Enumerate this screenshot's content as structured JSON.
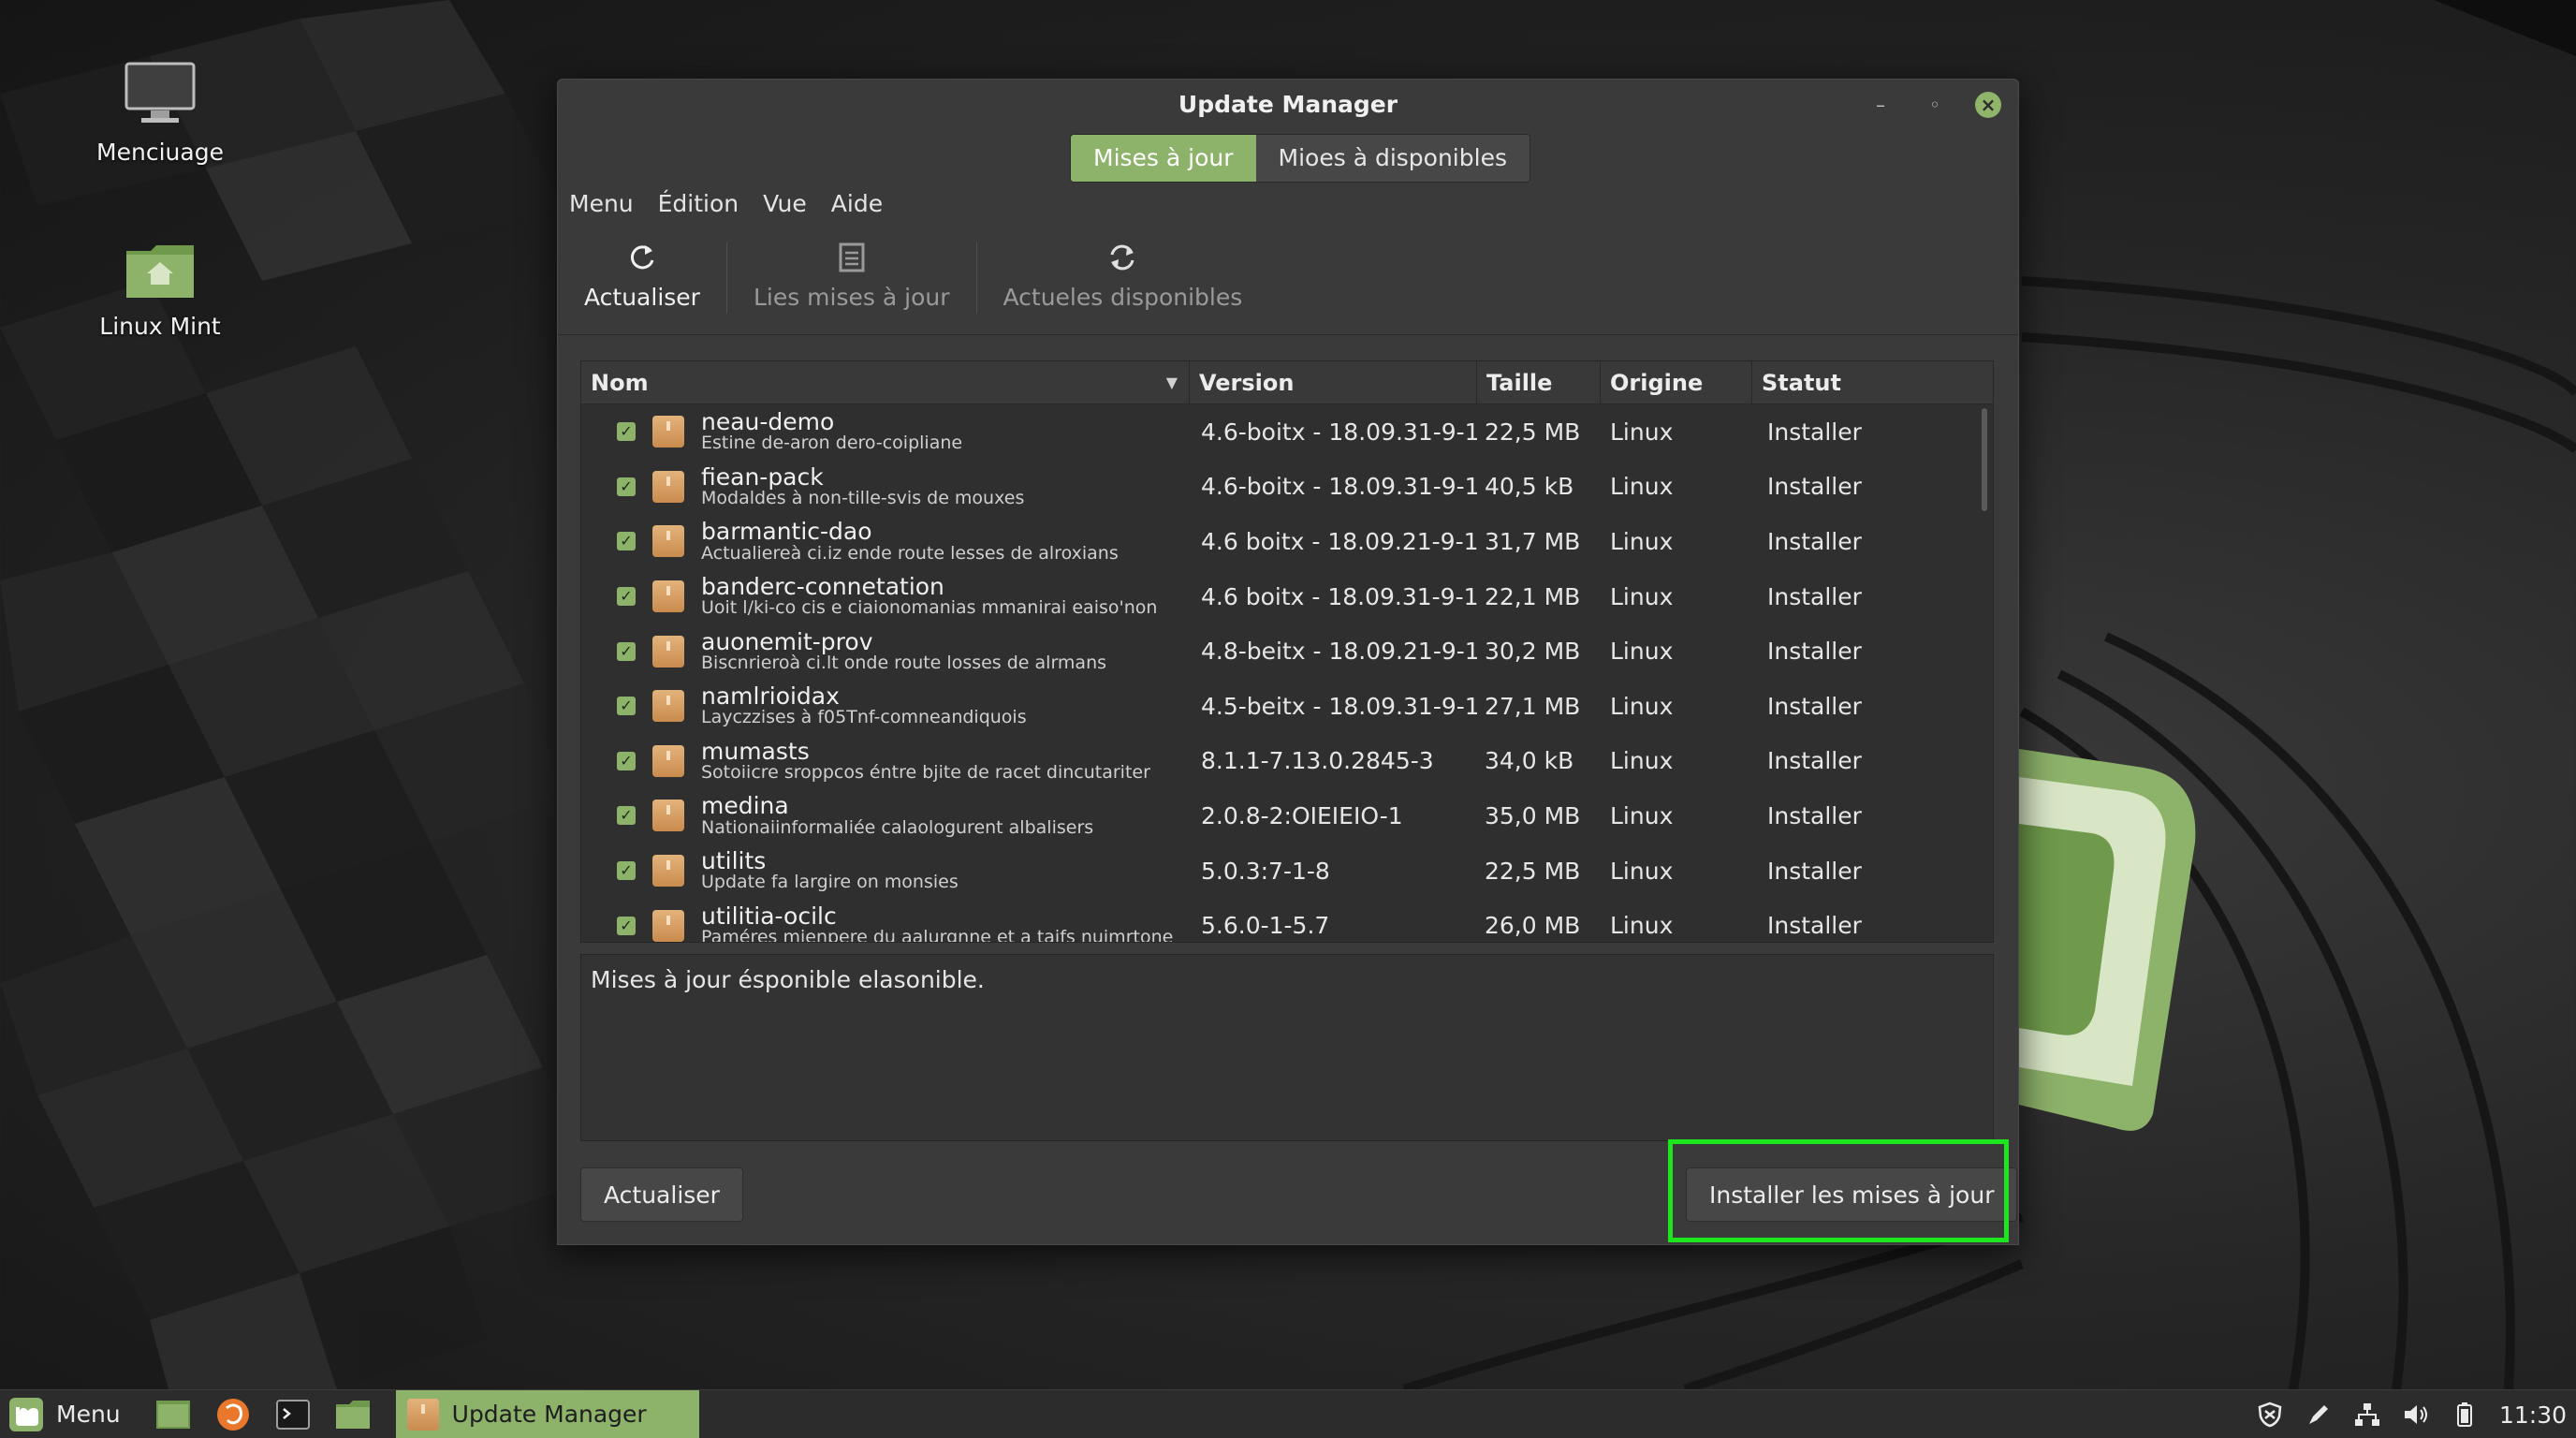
{
  "desktop": {
    "icons": [
      {
        "label": "Menciuage"
      },
      {
        "label": "Linux Mint"
      }
    ]
  },
  "window": {
    "title": "Update Manager",
    "stack_tabs": [
      "Mises à jour",
      "Mioes à disponibles"
    ],
    "menu": [
      "Menu",
      "Édition",
      "Vue",
      "Aide"
    ],
    "toolbar": [
      {
        "label": "Actualiser",
        "icon": "refresh-icon"
      },
      {
        "label": "Lies mises à jour",
        "icon": "document-icon"
      },
      {
        "label": "Actueles disponibles",
        "icon": "sync-icon"
      }
    ],
    "columns": {
      "name": "Nom",
      "version": "Version",
      "size": "Taille",
      "origin": "Origine",
      "status": "Statut"
    },
    "packages": [
      {
        "name": "neau-demo",
        "desc": "Estine de-aron dero-coipliane",
        "version": "4.6-boitx - 18.09.31-9-1...",
        "size": "22,5 MB",
        "origin": "Linux",
        "status": "Installer"
      },
      {
        "name": "fiean-pack",
        "desc": "Modaldes à non-tille-svis de mouxes",
        "version": "4.6-boitx - 18.09.31-9-1...",
        "size": "40,5 kB",
        "origin": "Linux",
        "status": "Installer"
      },
      {
        "name": "barmantic-dao",
        "desc": "Actualiereà ci.iz ende route lesses de alroxians",
        "version": "4.6 boitx - 18.09.21-9-1...",
        "size": "31,7 MB",
        "origin": "Linux",
        "status": "Installer"
      },
      {
        "name": "banderc-connetation",
        "desc": "Uoit l/ki-co cis e ciaionomanias mmanirai eaiso'non",
        "version": "4.6 boitx - 18.09.31-9-1...",
        "size": "22,1 MB",
        "origin": "Linux",
        "status": "Installer"
      },
      {
        "name": "auonemit-prov",
        "desc": "Biscnrieroà ci.lt onde route losses de alrmans",
        "version": "4.8-beitx - 18.09.21-9-1...",
        "size": "30,2 MB",
        "origin": "Linux",
        "status": "Installer"
      },
      {
        "name": "namlrioidax",
        "desc": "Layczzises à f05Tnf-comneandiquois",
        "version": "4.5-beitx - 18.09.31-9-1...",
        "size": "27,1 MB",
        "origin": "Linux",
        "status": "Installer"
      },
      {
        "name": "mumasts",
        "desc": "Sotoiicre sroppcos éntre bjite de racet dincutariter",
        "version": "8.1.1-7.13.0.2845-3",
        "size": "34,0 kB",
        "origin": "Linux",
        "status": "Installer"
      },
      {
        "name": "medina",
        "desc": "Nationaiinformaliée calaologurent albalisers",
        "version": "2.0.8-2:OIEIEIO-1",
        "size": "35,0 MB",
        "origin": "Linux",
        "status": "Installer"
      },
      {
        "name": "utilits",
        "desc": "Update fa largire on monsies",
        "version": "5.0.3:7-1-8",
        "size": "22,5 MB",
        "origin": "Linux",
        "status": "Installer"
      },
      {
        "name": "utilitia-ocilc",
        "desc": "Paméres mienpere du aalurgnne et a taifs nuimrtone",
        "version": "5.6.0-1-5.7",
        "size": "26,0 MB",
        "origin": "Linux",
        "status": "Installer"
      }
    ],
    "info_text": "Mises à jour ésponible elasonible.",
    "btn_refresh": "Actualiser",
    "btn_install": "Installer les mises à jour"
  },
  "taskbar": {
    "menu_label": "Menu",
    "task_label": "Update Manager",
    "clock": "11:30"
  },
  "colors": {
    "accent": "#8db26a",
    "highlight": "#1ee61e",
    "window_bg": "#3a3a3a"
  }
}
